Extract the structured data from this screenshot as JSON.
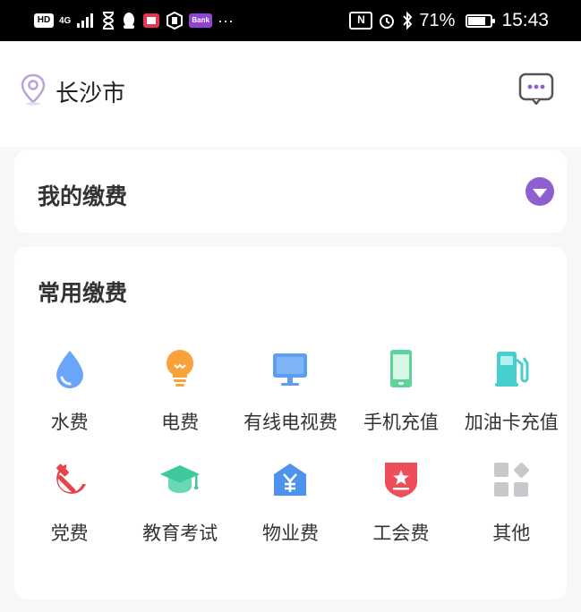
{
  "status_bar": {
    "hd": "HD",
    "net": "4G",
    "app_badge": "Bank",
    "more": "···",
    "nfc": "N",
    "battery_pct": "71%",
    "time": "15:43",
    "battery_level": 0.71
  },
  "header": {
    "city": "长沙市"
  },
  "my_payment": {
    "title": "我的缴费"
  },
  "common_payment": {
    "title": "常用缴费",
    "items": [
      {
        "label": "水费",
        "icon": "water-drop-icon",
        "color": "#6aa6f8"
      },
      {
        "label": "电费",
        "icon": "lightbulb-icon",
        "color": "#f9a23b"
      },
      {
        "label": "有线电视费",
        "icon": "tv-monitor-icon",
        "color": "#5b9ef2"
      },
      {
        "label": "手机充值",
        "icon": "mobile-phone-icon",
        "color": "#5ed49a"
      },
      {
        "label": "加油卡充值",
        "icon": "fuel-pump-icon",
        "color": "#47cfcf"
      },
      {
        "label": "党费",
        "icon": "hammer-sickle-icon",
        "color": "#e8434b"
      },
      {
        "label": "教育考试",
        "icon": "graduation-cap-icon",
        "color": "#3fc79e"
      },
      {
        "label": "物业费",
        "icon": "property-building-icon",
        "color": "#4d93ec"
      },
      {
        "label": "工会费",
        "icon": "union-shield-icon",
        "color": "#ee4d5a"
      },
      {
        "label": "其他",
        "icon": "grid-other-icon",
        "color": "#c8c8cc"
      }
    ]
  }
}
